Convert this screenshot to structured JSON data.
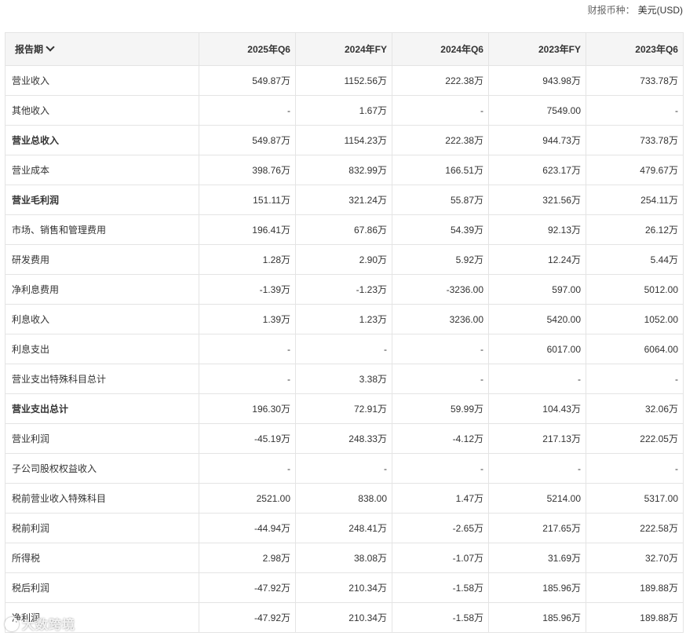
{
  "currency": {
    "label": "财报币种：",
    "value": "美元(USD)"
  },
  "header": {
    "period_label": "报告期",
    "columns": [
      "2025年Q6",
      "2024年FY",
      "2024年Q6",
      "2023年FY",
      "2023年Q6"
    ]
  },
  "rows": [
    {
      "label": "营业收入",
      "bold": false,
      "values": [
        "549.87万",
        "1152.56万",
        "222.38万",
        "943.98万",
        "733.78万"
      ]
    },
    {
      "label": "其他收入",
      "bold": false,
      "values": [
        "-",
        "1.67万",
        "-",
        "7549.00",
        "-"
      ]
    },
    {
      "label": "营业总收入",
      "bold": true,
      "values": [
        "549.87万",
        "1154.23万",
        "222.38万",
        "944.73万",
        "733.78万"
      ]
    },
    {
      "label": "营业成本",
      "bold": false,
      "values": [
        "398.76万",
        "832.99万",
        "166.51万",
        "623.17万",
        "479.67万"
      ]
    },
    {
      "label": "营业毛利润",
      "bold": true,
      "values": [
        "151.11万",
        "321.24万",
        "55.87万",
        "321.56万",
        "254.11万"
      ]
    },
    {
      "label": "市场、销售和管理费用",
      "bold": false,
      "values": [
        "196.41万",
        "67.86万",
        "54.39万",
        "92.13万",
        "26.12万"
      ]
    },
    {
      "label": "研发费用",
      "bold": false,
      "values": [
        "1.28万",
        "2.90万",
        "5.92万",
        "12.24万",
        "5.44万"
      ]
    },
    {
      "label": "净利息费用",
      "bold": false,
      "values": [
        "-1.39万",
        "-1.23万",
        "-3236.00",
        "597.00",
        "5012.00"
      ]
    },
    {
      "label": "利息收入",
      "bold": false,
      "values": [
        "1.39万",
        "1.23万",
        "3236.00",
        "5420.00",
        "1052.00"
      ]
    },
    {
      "label": "利息支出",
      "bold": false,
      "values": [
        "-",
        "-",
        "-",
        "6017.00",
        "6064.00"
      ]
    },
    {
      "label": "营业支出特殊科目总计",
      "bold": false,
      "values": [
        "-",
        "3.38万",
        "-",
        "-",
        "-"
      ]
    },
    {
      "label": "营业支出总计",
      "bold": true,
      "values": [
        "196.30万",
        "72.91万",
        "59.99万",
        "104.43万",
        "32.06万"
      ]
    },
    {
      "label": "营业利润",
      "bold": false,
      "values": [
        "-45.19万",
        "248.33万",
        "-4.12万",
        "217.13万",
        "222.05万"
      ]
    },
    {
      "label": "子公司股权权益收入",
      "bold": false,
      "values": [
        "-",
        "-",
        "-",
        "-",
        "-"
      ]
    },
    {
      "label": "税前营业收入特殊科目",
      "bold": false,
      "values": [
        "2521.00",
        "838.00",
        "1.47万",
        "5214.00",
        "5317.00"
      ]
    },
    {
      "label": "税前利润",
      "bold": false,
      "values": [
        "-44.94万",
        "248.41万",
        "-2.65万",
        "217.65万",
        "222.58万"
      ]
    },
    {
      "label": "所得税",
      "bold": false,
      "values": [
        "2.98万",
        "38.08万",
        "-1.07万",
        "31.69万",
        "32.70万"
      ]
    },
    {
      "label": "税后利润",
      "bold": false,
      "values": [
        "-47.92万",
        "210.34万",
        "-1.58万",
        "185.96万",
        "189.88万"
      ]
    },
    {
      "label": "净利润",
      "bold": false,
      "values": [
        "-47.92万",
        "210.34万",
        "-1.58万",
        "185.96万",
        "189.88万"
      ]
    }
  ],
  "watermark": {
    "text": "大数跨境"
  }
}
